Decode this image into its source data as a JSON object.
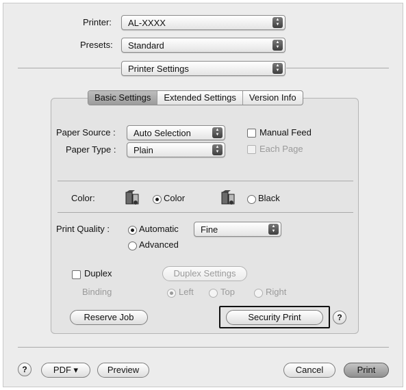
{
  "printer": {
    "label": "Printer:",
    "value": "AL-XXXX"
  },
  "presets": {
    "label": "Presets:",
    "value": "Standard"
  },
  "panel_select": {
    "value": "Printer Settings"
  },
  "tabs": [
    {
      "label": "Basic Settings",
      "active": true
    },
    {
      "label": "Extended Settings",
      "active": false
    },
    {
      "label": "Version Info",
      "active": false
    }
  ],
  "paper_source": {
    "label": "Paper Source :",
    "value": "Auto Selection"
  },
  "paper_type": {
    "label": "Paper Type :",
    "value": "Plain"
  },
  "manual_feed": {
    "label": "Manual Feed",
    "checked": false
  },
  "each_page": {
    "label": "Each Page",
    "checked": false,
    "enabled": false
  },
  "color": {
    "label": "Color:",
    "options": [
      {
        "label": "Color",
        "selected": true,
        "icon": "color-ink-icon"
      },
      {
        "label": "Black",
        "selected": false,
        "icon": "black-ink-icon"
      }
    ]
  },
  "print_quality": {
    "label": "Print Quality :",
    "automatic_label": "Automatic",
    "advanced_label": "Advanced",
    "selected": "Automatic",
    "level": "Fine"
  },
  "duplex": {
    "label": "Duplex",
    "checked": false,
    "settings_button": "Duplex Settings",
    "binding_label": "Binding",
    "binding_options": [
      "Left",
      "Top",
      "Right"
    ],
    "binding_selected": "Left"
  },
  "reserve_job_button": "Reserve Job",
  "security_print_button": "Security Print",
  "help_symbol": "?",
  "bottom": {
    "pdf_button": "PDF ▾",
    "preview_button": "Preview",
    "cancel_button": "Cancel",
    "print_button": "Print"
  },
  "colors": {
    "highlight_border": "#111111",
    "default_button": "#a8a8a8"
  }
}
